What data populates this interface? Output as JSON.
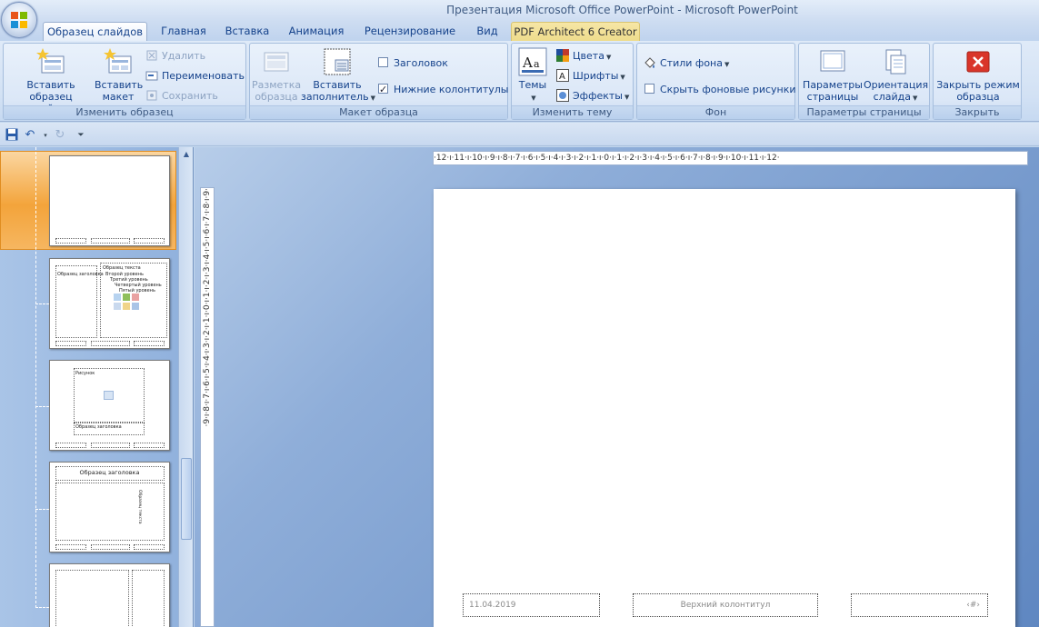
{
  "window": {
    "title": "Презентация Microsoft Office PowerPoint - Microsoft PowerPoint"
  },
  "tabs": [
    "Образец слайдов",
    "Главная",
    "Вставка",
    "Анимация",
    "Рецензирование",
    "Вид",
    "PDF Architect 6 Creator"
  ],
  "ribbon": {
    "edit_master": {
      "label": "Изменить образец",
      "insert_master_l1": "Вставить",
      "insert_master_l2": "образец слайдов",
      "insert_layout_l1": "Вставить",
      "insert_layout_l2": "макет",
      "delete": "Удалить",
      "rename": "Переименовать",
      "preserve": "Сохранить"
    },
    "master_layout": {
      "label": "Макет образца",
      "layout_l1": "Разметка",
      "layout_l2": "образца",
      "insert_ph_l1": "Вставить",
      "insert_ph_l2": "заполнитель",
      "title_chk": "Заголовок",
      "footers_chk": "Нижние колонтитулы"
    },
    "edit_theme": {
      "label": "Изменить тему",
      "themes": "Темы",
      "colors": "Цвета",
      "fonts": "Шрифты",
      "effects": "Эффекты"
    },
    "background": {
      "label": "Фон",
      "styles": "Стили фона",
      "hide_bg": "Скрыть фоновые рисунки"
    },
    "page_setup": {
      "label": "Параметры страницы",
      "setup_l1": "Параметры",
      "setup_l2": "страницы",
      "orient_l1": "Ориентация",
      "orient_l2": "слайда"
    },
    "close": {
      "label": "Закрыть",
      "close_l1": "Закрыть режим",
      "close_l2": "образца"
    }
  },
  "thumbs": {
    "t2_title": "Образец заголовка",
    "t2_text": "Образец текста",
    "t2_l2": "Второй уровень",
    "t2_l3": "Третий уровень",
    "t2_l4": "Четвертый уровень",
    "t2_l5": "Пятый уровень",
    "t3_pic": "Рисунок",
    "t3_title": "Образец заголовка",
    "t4_title": "Образец заголовка",
    "t4_text": "Образец текста"
  },
  "rulers": {
    "h": "·12·ı·11·ı·10·ı·9·ı·8·ı·7·ı·6·ı·5·ı·4·ı·3·ı·2·ı·1·ı·0·ı·1·ı·2·ı·3·ı·4·ı·5·ı·6·ı·7·ı·8·ı·9·ı·10·ı·11·ı·12·",
    "v": "·9·ı·8·ı·7·ı·6·ı·5·ı·4·ı·3·ı·2·ı·1·ı·0·ı·1·ı·2·ı·3·ı·4·ı·5·ı·6·ı·7·ı·8·ı·9·"
  },
  "slide": {
    "date": "11.04.2019",
    "footer": "Верхний колонтитул",
    "number": "‹#›"
  }
}
